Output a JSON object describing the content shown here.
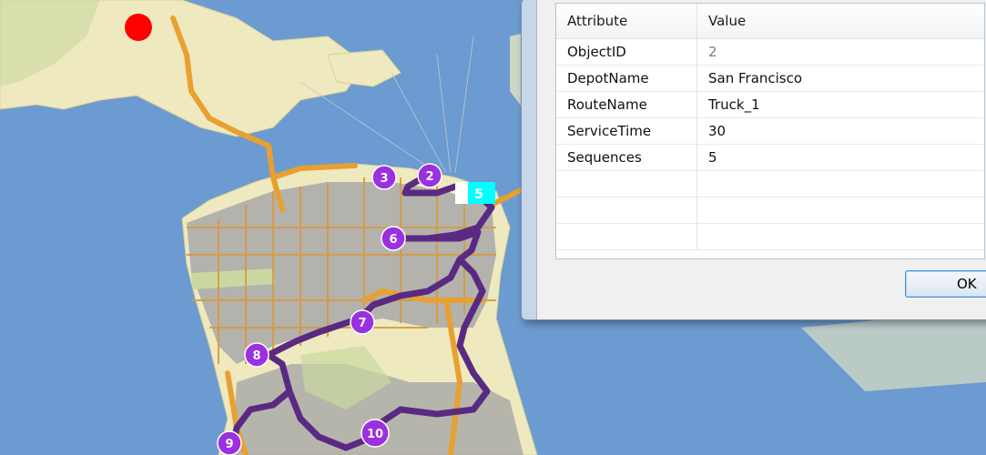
{
  "map": {
    "stops": [
      {
        "label": "2"
      },
      {
        "label": "3"
      },
      {
        "label": "5"
      },
      {
        "label": "6"
      },
      {
        "label": "7"
      },
      {
        "label": "8"
      },
      {
        "label": "9"
      },
      {
        "label": "10"
      }
    ],
    "colors": {
      "water": "#6b9bd1",
      "land": "#efe9bf",
      "urban": "#a8a8a8",
      "highway": "#e8a030",
      "route": "#5a2a82",
      "stop_marker": "#9b30e0",
      "depot_marker": "#00ffff",
      "origin_marker": "#ff0000"
    }
  },
  "dialog": {
    "table": {
      "headers": [
        "Attribute",
        "Value"
      ],
      "rows": [
        {
          "attribute": "ObjectID",
          "value": "2"
        },
        {
          "attribute": "DepotName",
          "value": "San Francisco"
        },
        {
          "attribute": "RouteName",
          "value": "Truck_1"
        },
        {
          "attribute": "ServiceTime",
          "value": "30"
        },
        {
          "attribute": "Sequences",
          "value": "5"
        }
      ]
    },
    "ok_label": "OK"
  }
}
